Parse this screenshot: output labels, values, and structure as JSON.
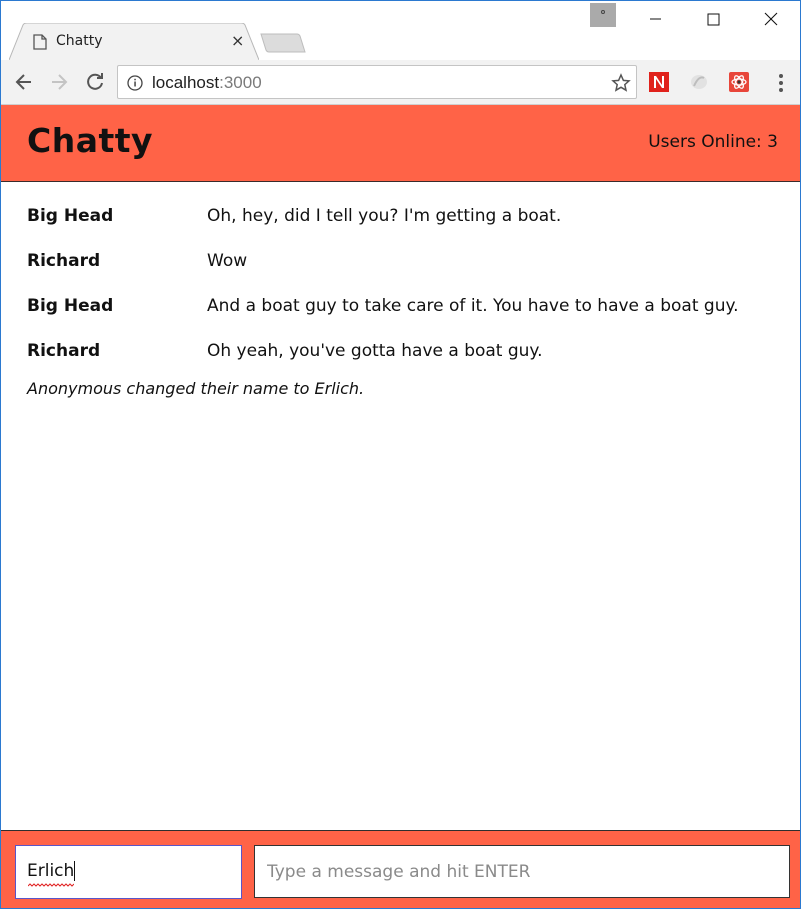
{
  "browser": {
    "tab": {
      "title": "Chatty",
      "close_glyph": "×"
    },
    "address": {
      "host": "localhost",
      "port": ":3000"
    },
    "icons": [
      "page-icon",
      "back-icon",
      "forward-icon",
      "reload-icon",
      "info-icon",
      "star-icon",
      "extension-n-icon",
      "extension-swirl-icon",
      "extension-react-icon",
      "menu-icon",
      "minimize-icon",
      "maximize-icon",
      "close-icon"
    ],
    "colors": {
      "frame": "#ffffff",
      "toolbar": "#f2f2f2",
      "ext_red": "#e0221c"
    }
  },
  "app": {
    "brand": "Chatty",
    "users_online": "Users Online: 3",
    "colors": {
      "accent": "#ff6347",
      "text": "#111111"
    },
    "messages": [
      {
        "user": "Big Head",
        "content": "Oh, hey, did I tell you? I'm getting a boat."
      },
      {
        "user": "Richard",
        "content": "Wow"
      },
      {
        "user": "Big Head",
        "content": "And a boat guy to take care of it. You have to have a boat guy."
      },
      {
        "user": "Richard",
        "content": "Oh yeah, you've gotta have a boat guy."
      }
    ],
    "system_notification": "Anonymous changed their name to Erlich.",
    "chatbar": {
      "username_value": "Erlich",
      "message_placeholder": "Type a message and hit ENTER"
    }
  }
}
